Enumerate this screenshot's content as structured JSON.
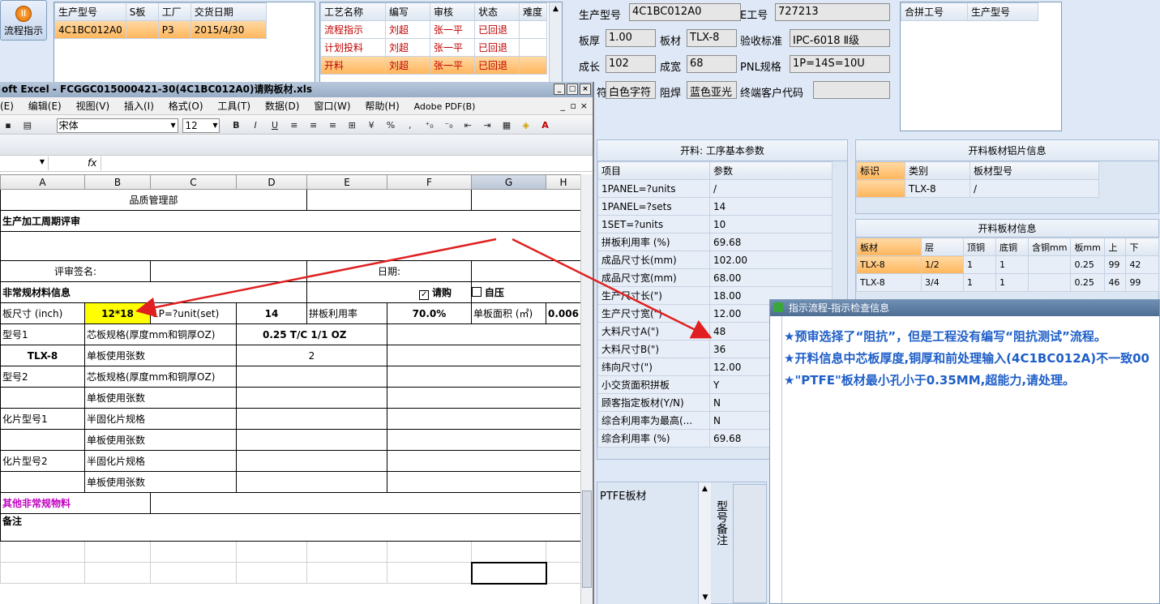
{
  "left_button": {
    "label": "流程指示"
  },
  "order_table": {
    "headers": [
      "生产型号",
      "S板",
      "工厂",
      "交货日期"
    ],
    "rows": [
      [
        "4C1BC012A0",
        "",
        "P3",
        "2015/4/30"
      ]
    ]
  },
  "process_table": {
    "headers": [
      "工艺名称",
      "编写",
      "审核",
      "状态",
      "难度"
    ],
    "rows": [
      [
        "流程指示",
        "刘超",
        "张一平",
        "已回退",
        ""
      ],
      [
        "计划投料",
        "刘超",
        "张一平",
        "已回退",
        ""
      ],
      [
        "开料",
        "刘超",
        "张一平",
        "已回退",
        ""
      ]
    ]
  },
  "info_fields": {
    "model_label": "生产型号",
    "model_value": "4C1BC012A0",
    "e_label": "E工号",
    "e_value": "727213",
    "thick_label": "板厚",
    "thick_value": "1.00",
    "material_label": "板材",
    "material_value": "TLX-8",
    "accept_label": "验收标准",
    "accept_value": "IPC-6018 Ⅱ级",
    "long_label": "成长",
    "long_value": "102",
    "wide_label": "成宽",
    "wide_value": "68",
    "pnl_label": "PNL规格",
    "pnl_value": "1P=14S=10U",
    "char_label": "符",
    "char_value": "白色字符",
    "mask_label": "阻焊",
    "mask_value": "蓝色亚光",
    "cust_label": "终端客户代码",
    "cust_value": ""
  },
  "merge_table": {
    "headers": [
      "合拼工号",
      "生产型号"
    ]
  },
  "excel": {
    "title": "oft Excel - FCGGC015000421-30(4C1BC012A0)请购板材.xls",
    "menu": [
      "(E)",
      "编辑(E)",
      "视图(V)",
      "插入(I)",
      "格式(O)",
      "工具(T)",
      "数据(D)",
      "窗口(W)",
      "帮助(H)",
      "Adobe PDF(B)"
    ],
    "font_name": "宋体",
    "font_size": "12",
    "fx": "fx",
    "columns": [
      "A",
      "B",
      "C",
      "D",
      "E",
      "F",
      "G",
      "H"
    ],
    "dept": "品质管理部",
    "title_row": "生产加工周期评审",
    "sign_label": "评审签名:",
    "date_label": "日期:",
    "nonstd_label": "非常规材料信息",
    "purchase_label": "请购",
    "press_label": "自压",
    "size_label": "板尺寸 (inch)",
    "size_value": "12*18",
    "pcs_label": "1P=?unit(set)",
    "pcs_value": "14",
    "util_label": "拼板利用率",
    "util_value": "70.0%",
    "area_label": "单板面积 (㎡)",
    "area_value": "0.006",
    "type1_label": "型号1",
    "core_label": "芯板规格(厚度mm和铜厚OZ)",
    "core_value": "0.25 T/C 1/1 OZ",
    "tlx_value": "TLX-8",
    "sheet_label": "单板使用张数",
    "sheet_value": "2",
    "type2_label": "型号2",
    "core2_label": "芯板规格(厚度mm和铜厚OZ)",
    "sheet2_label": "单板使用张数",
    "pp1_label": "化片型号1",
    "pp_label": "半固化片规格",
    "sheet3_label": "单板使用张数",
    "pp2_label": "化片型号2",
    "pp2spec_label": "半固化片规格",
    "sheet4_label": "单板使用张数",
    "other_label": "其他非常规物料",
    "remark_label": "备注"
  },
  "cut_params": {
    "title": "开料: 工序基本参数",
    "headers": [
      "项目",
      "参数"
    ],
    "rows": [
      [
        "1PANEL=?units",
        "/"
      ],
      [
        "1PANEL=?sets",
        "14"
      ],
      [
        "1SET=?units",
        "10"
      ],
      [
        "拼板利用率 (%)",
        "69.68"
      ],
      [
        "成品尺寸长(mm)",
        "102.00"
      ],
      [
        "成品尺寸宽(mm)",
        "68.00"
      ],
      [
        "生产尺寸长(\")",
        "18.00"
      ],
      [
        "生产尺寸宽(\")",
        "12.00"
      ],
      [
        "大料尺寸A(\")",
        "48"
      ],
      [
        "大料尺寸B(\")",
        "36"
      ],
      [
        "纬向尺寸(\")",
        "12.00"
      ],
      [
        "小交货面积拼板",
        "Y"
      ],
      [
        "顾客指定板材(Y/N)",
        "N"
      ],
      [
        "综合利用率为最高(...",
        "N"
      ],
      [
        "综合利用率 (%)",
        "69.68"
      ]
    ]
  },
  "al_sheet": {
    "title": "开料板材铝片信息",
    "headers": [
      "标识",
      "类别",
      "板材型号"
    ],
    "rows": [
      [
        "",
        "TLX-8",
        "/"
      ]
    ]
  },
  "material_info": {
    "title": "开料板材信息",
    "headers": [
      "板材",
      "层",
      "顶铜",
      "底铜",
      "含铜mm",
      "板mm",
      "上",
      "下"
    ],
    "rows": [
      [
        "TLX-8",
        "1/2",
        "1",
        "1",
        "",
        "0.25",
        "99",
        "42"
      ],
      [
        "TLX-8",
        "3/4",
        "1",
        "1",
        "",
        "0.25",
        "46",
        "99"
      ]
    ]
  },
  "ptfe": {
    "label": "PTFE板材",
    "side_label": "型号备注"
  },
  "popup": {
    "title": "指示流程-指示检查信息",
    "lines": [
      "★预审选择了“阻抗”，但是工程没有编写“阻抗测试”流程。",
      "★开料信息中芯板厚度,铜厚和前处理输入(4C1BC012A)不一致00",
      "★\"PTFE\"板材最小孔小于0.35MM,超能力,请处理。"
    ]
  },
  "colors": {
    "accent_red": "#e02020",
    "popup_blue": "#1f5fc8",
    "highlight": "#ffff00",
    "selection": "#ffb55a"
  }
}
